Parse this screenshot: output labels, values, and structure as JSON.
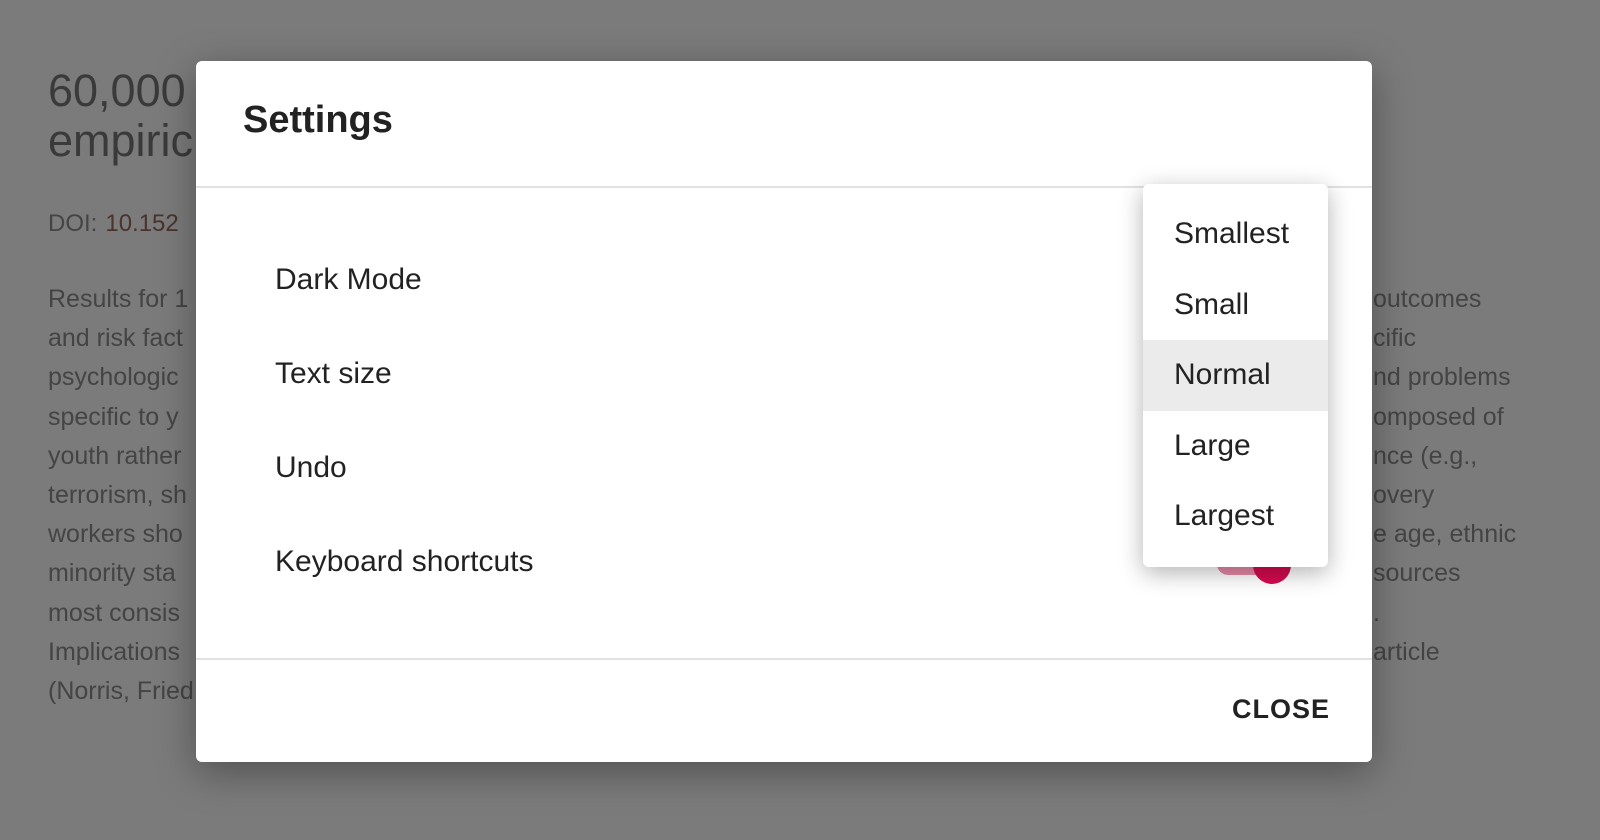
{
  "background": {
    "title_lines": [
      "60,000",
      "empiric"
    ],
    "doi_label": "DOI:",
    "doi_value": "10.152",
    "left_lines": [
      "Results for 1",
      "and risk fact",
      "psychologic",
      "specific to y",
      "youth rather",
      "terrorism, sh",
      "workers sho",
      "minority sta",
      "most consis",
      "Implications",
      "(Norris, Fried"
    ],
    "right_lines": [
      "outcomes",
      "cific",
      "nd problems",
      "omposed of",
      "nce (e.g.,",
      "overy",
      "e age, ethnic",
      "sources",
      ".",
      "article",
      ""
    ]
  },
  "dialog": {
    "title": "Settings",
    "rows": [
      "Dark Mode",
      "Text size",
      "Undo",
      "Keyboard shortcuts"
    ],
    "close_label": "CLOSE",
    "keyboard_shortcuts_enabled": true
  },
  "text_size_menu": {
    "options": [
      "Smallest",
      "Small",
      "Normal",
      "Large",
      "Largest"
    ],
    "selected": "Normal"
  },
  "colors": {
    "accent": "#d60a4f",
    "overlay": "#7b7b7b"
  }
}
